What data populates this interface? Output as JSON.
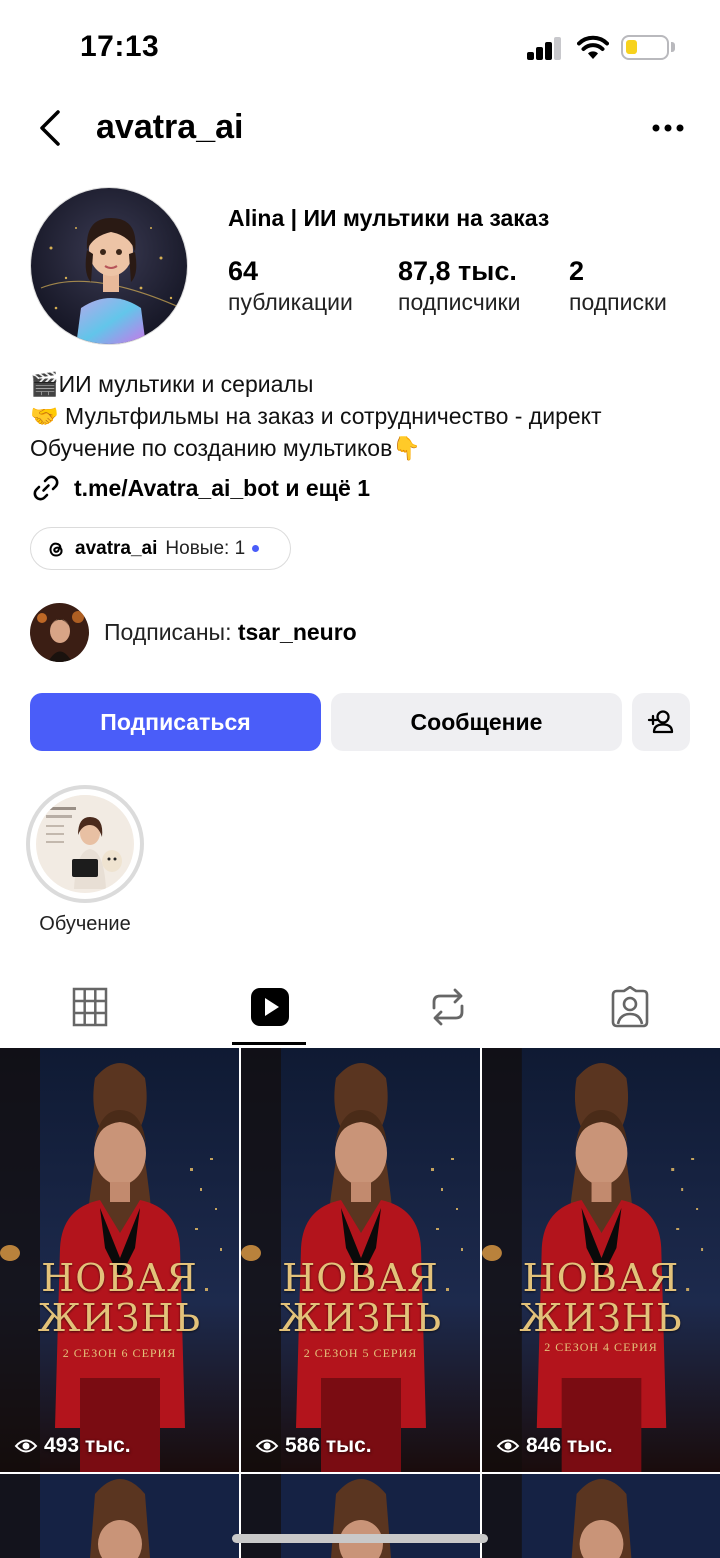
{
  "status_bar": {
    "time": "17:13",
    "icons": [
      "cellular-signal-icon",
      "wifi-icon",
      "battery-icon"
    ],
    "battery_color": "#f7d21d"
  },
  "header": {
    "username": "avatra_ai",
    "back_icon": "chevron-left-icon",
    "more_icon": "more-horizontal-icon"
  },
  "profile": {
    "display_name": "Alina | ИИ мультики на заказ",
    "stats": [
      {
        "value": "64",
        "label": "публикации"
      },
      {
        "value": "87,8 тыс.",
        "label": "подписчики"
      },
      {
        "value": "2",
        "label": "подписки"
      }
    ],
    "bio": [
      "🎬ИИ мультики и сериалы",
      "🤝 Мультфильмы на заказ и сотрудничество - директ",
      "Обучение по созданию мультиков👇"
    ],
    "link": "t.me/Avatra_ai_bot и ещё 1",
    "threads": {
      "username": "avatra_ai",
      "new_label": "Новые: 1"
    },
    "followed_by": {
      "prefix": "Подписаны: ",
      "name": "tsar_neuro"
    }
  },
  "actions": {
    "follow": "Подписаться",
    "message": "Сообщение",
    "suggest_icon": "add-person-icon"
  },
  "highlights": [
    {
      "label": "Обучение"
    }
  ],
  "tabs": [
    {
      "name": "grid",
      "icon": "grid-icon",
      "active": false
    },
    {
      "name": "reels",
      "icon": "reels-icon",
      "active": true
    },
    {
      "name": "reposts",
      "icon": "repost-icon",
      "active": false
    },
    {
      "name": "tagged",
      "icon": "tagged-person-icon",
      "active": false
    }
  ],
  "reels": [
    {
      "title_line1": "НОВАЯ",
      "title_line2": "ЖИЗНЬ",
      "subtitle": "2 СЕЗОН 6 СЕРИЯ",
      "views": "493 тыс."
    },
    {
      "title_line1": "НОВАЯ",
      "title_line2": "ЖИЗНЬ",
      "subtitle": "2 СЕЗОН 5 СЕРИЯ",
      "views": "586 тыс."
    },
    {
      "title_line1": "НОВАЯ",
      "title_line2": "ЖИЗНЬ",
      "subtitle": "2 СЕЗОН 4 СЕРИЯ",
      "views": "846 тыс."
    }
  ],
  "colors": {
    "accent": "#4a5df9",
    "secondary_button": "#efeff2",
    "reel_title": "#e3c27a",
    "reel_red": "#b3141c"
  }
}
